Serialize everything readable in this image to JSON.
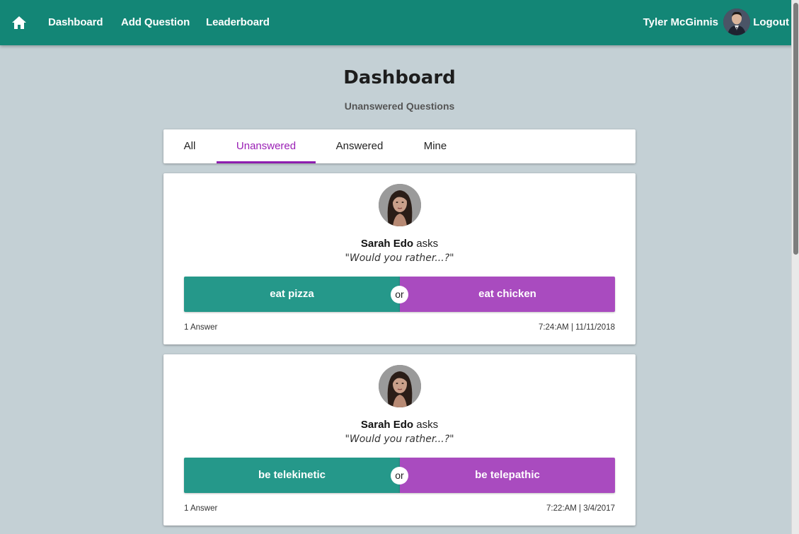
{
  "nav": {
    "home_icon": "home-icon",
    "links": [
      "Dashboard",
      "Add Question",
      "Leaderboard"
    ],
    "user_name": "Tyler McGinnis",
    "logout_label": "Logout",
    "bar_color": "#138676"
  },
  "page": {
    "title": "Dashboard",
    "subtitle": "Unanswered Questions"
  },
  "tabs": [
    {
      "label": "All",
      "active": false
    },
    {
      "label": "Unanswered",
      "active": true
    },
    {
      "label": "Answered",
      "active": false
    },
    {
      "label": "Mine",
      "active": false
    }
  ],
  "questions": [
    {
      "author": "Sarah Edo",
      "asks_word": "asks",
      "prompt": "\"Would you rather...?\"",
      "option_one": "eat pizza",
      "or_label": "or",
      "option_two": "eat chicken",
      "answers": "1 Answer",
      "timestamp": "7:24:AM | 11/11/2018"
    },
    {
      "author": "Sarah Edo",
      "asks_word": "asks",
      "prompt": "\"Would you rather...?\"",
      "option_one": "be telekinetic",
      "or_label": "or",
      "option_two": "be telepathic",
      "answers": "1 Answer",
      "timestamp": "7:22:AM | 3/4/2017"
    }
  ],
  "colors": {
    "option_one": "#25988a",
    "option_two": "#a94bbf",
    "active_tab": "#9a1fb5",
    "background": "#c4d0d5"
  }
}
